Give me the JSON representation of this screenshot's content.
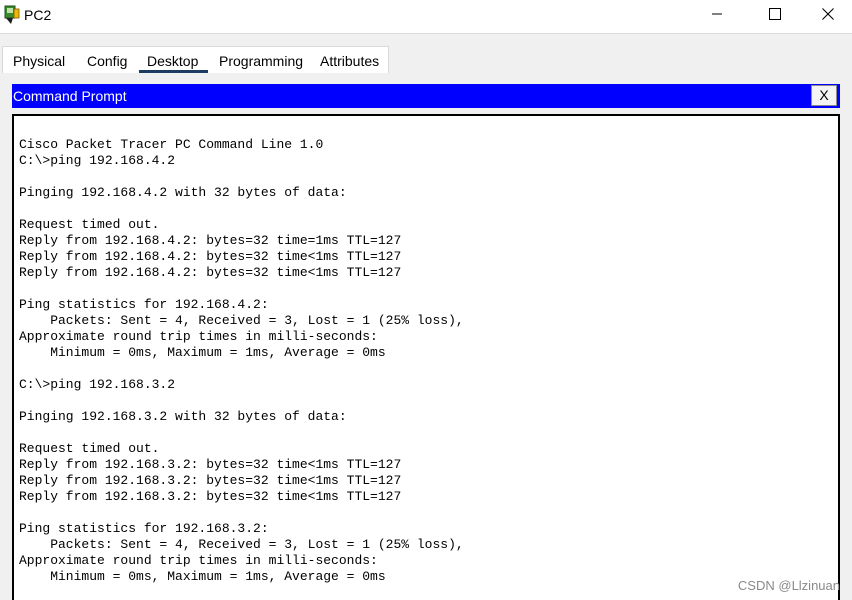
{
  "window": {
    "title": "PC2",
    "icons": {
      "app": "packet-tracer-pc-icon",
      "minimize": "minimize-icon",
      "maximize": "maximize-icon",
      "close": "close-icon"
    }
  },
  "tabs": [
    {
      "label": "Physical",
      "active": false
    },
    {
      "label": "Config",
      "active": false
    },
    {
      "label": "Desktop",
      "active": true
    },
    {
      "label": "Programming",
      "active": false
    },
    {
      "label": "Attributes",
      "active": false
    }
  ],
  "command_prompt": {
    "title": "Command Prompt",
    "close_label": "X",
    "header_color": "#0000ff",
    "lines": [
      "Cisco Packet Tracer PC Command Line 1.0",
      "C:\\>ping 192.168.4.2",
      "",
      "Pinging 192.168.4.2 with 32 bytes of data:",
      "",
      "Request timed out.",
      "Reply from 192.168.4.2: bytes=32 time=1ms TTL=127",
      "Reply from 192.168.4.2: bytes=32 time<1ms TTL=127",
      "Reply from 192.168.4.2: bytes=32 time<1ms TTL=127",
      "",
      "Ping statistics for 192.168.4.2:",
      "    Packets: Sent = 4, Received = 3, Lost = 1 (25% loss),",
      "Approximate round trip times in milli-seconds:",
      "    Minimum = 0ms, Maximum = 1ms, Average = 0ms",
      "",
      "C:\\>ping 192.168.3.2",
      "",
      "Pinging 192.168.3.2 with 32 bytes of data:",
      "",
      "Request timed out.",
      "Reply from 192.168.3.2: bytes=32 time<1ms TTL=127",
      "Reply from 192.168.3.2: bytes=32 time<1ms TTL=127",
      "Reply from 192.168.3.2: bytes=32 time<1ms TTL=127",
      "",
      "Ping statistics for 192.168.3.2:",
      "    Packets: Sent = 4, Received = 3, Lost = 1 (25% loss),",
      "Approximate round trip times in milli-seconds:",
      "    Minimum = 0ms, Maximum = 1ms, Average = 0ms"
    ]
  },
  "watermark": "CSDN @Llzinuan"
}
